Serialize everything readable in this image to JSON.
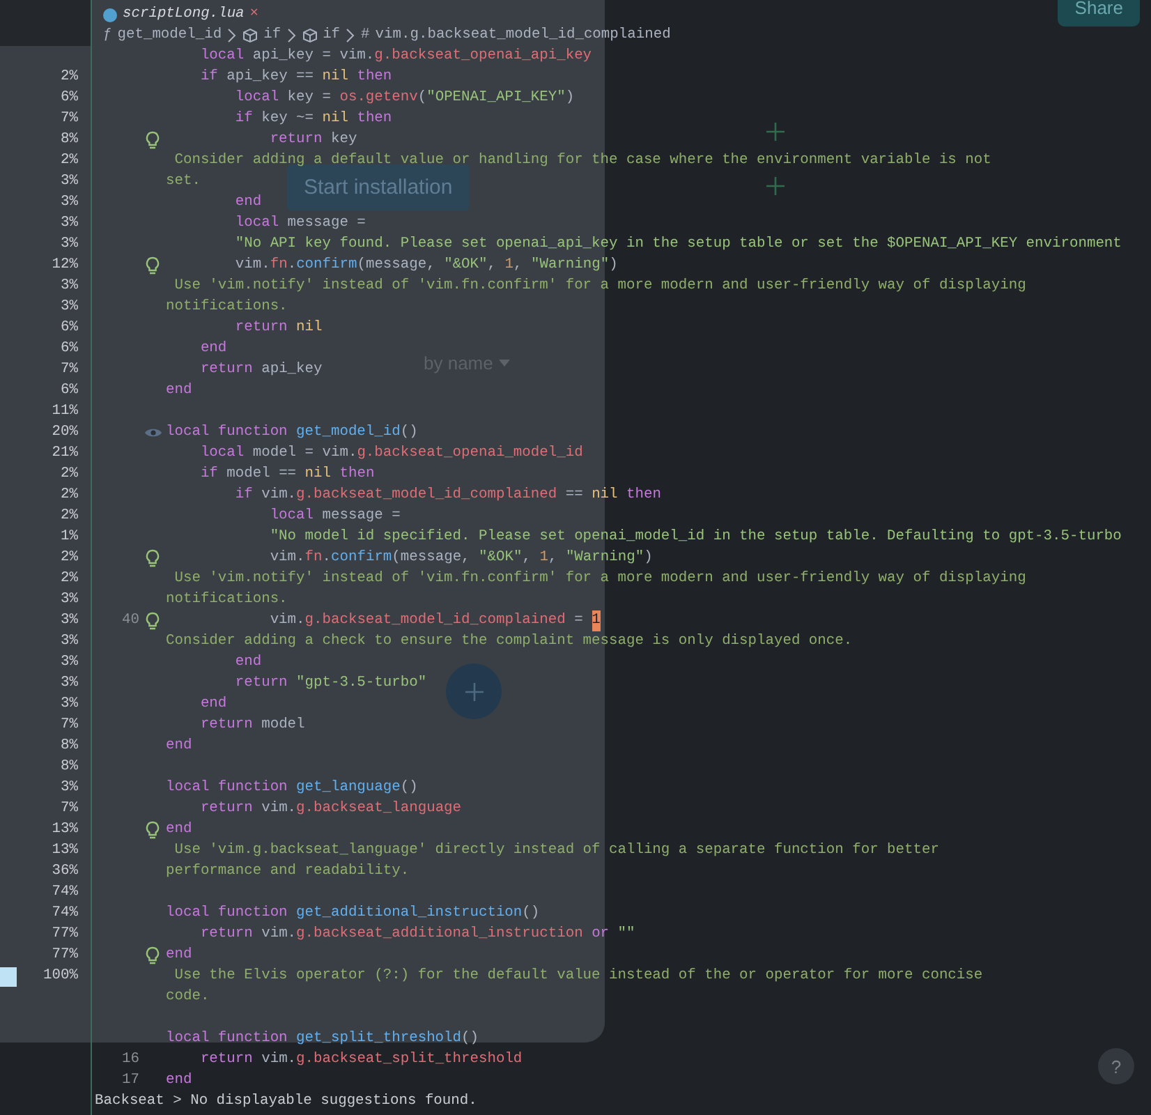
{
  "background_app": {
    "share_button": "Share",
    "install_button": "Start installation",
    "sort": "by name",
    "help_button": "?",
    "percentages": [
      {
        "value": "2%",
        "selected": false
      },
      {
        "value": "6%",
        "selected": false
      },
      {
        "value": "7%",
        "selected": false
      },
      {
        "value": "8%",
        "selected": false
      },
      {
        "value": "2%",
        "selected": false
      },
      {
        "value": "3%",
        "selected": false
      },
      {
        "value": "3%",
        "selected": false
      },
      {
        "value": "3%",
        "selected": false
      },
      {
        "value": "3%",
        "selected": false
      },
      {
        "value": "12%",
        "selected": false
      },
      {
        "value": "3%",
        "selected": false
      },
      {
        "value": "3%",
        "selected": false
      },
      {
        "value": "6%",
        "selected": false
      },
      {
        "value": "6%",
        "selected": false
      },
      {
        "value": "7%",
        "selected": false
      },
      {
        "value": "6%",
        "selected": false
      },
      {
        "value": "11%",
        "selected": false
      },
      {
        "value": "20%",
        "selected": false
      },
      {
        "value": "21%",
        "selected": false
      },
      {
        "value": "2%",
        "selected": false
      },
      {
        "value": "2%",
        "selected": false
      },
      {
        "value": "2%",
        "selected": false
      },
      {
        "value": "1%",
        "selected": false
      },
      {
        "value": "2%",
        "selected": false
      },
      {
        "value": "2%",
        "selected": false
      },
      {
        "value": "3%",
        "selected": false
      },
      {
        "value": "3%",
        "selected": false
      },
      {
        "value": "3%",
        "selected": false
      },
      {
        "value": "3%",
        "selected": false
      },
      {
        "value": "3%",
        "selected": false
      },
      {
        "value": "3%",
        "selected": false
      },
      {
        "value": "7%",
        "selected": false
      },
      {
        "value": "8%",
        "selected": false
      },
      {
        "value": "8%",
        "selected": false
      },
      {
        "value": "3%",
        "selected": false
      },
      {
        "value": "7%",
        "selected": false
      },
      {
        "value": "13%",
        "selected": false
      },
      {
        "value": "13%",
        "selected": false
      },
      {
        "value": "36%",
        "selected": false
      },
      {
        "value": "74%",
        "selected": false
      },
      {
        "value": "74%",
        "selected": false
      },
      {
        "value": "77%",
        "selected": false
      },
      {
        "value": "77%",
        "selected": false
      },
      {
        "value": "100%",
        "selected": true
      }
    ]
  },
  "tab": {
    "filename": "scriptLong.lua",
    "close": "×"
  },
  "breadcrumb": [
    {
      "kind": "function",
      "symbol": "ƒ",
      "text": "get_model_id"
    },
    {
      "kind": "block",
      "text": "if"
    },
    {
      "kind": "block",
      "text": "if"
    },
    {
      "kind": "variable",
      "symbol": "#",
      "text": "vim.g.backseat_model_id_complained"
    }
  ],
  "lines": [
    {
      "kind": "code",
      "tokens": [
        {
          "kind": "keyword",
          "text": "    local"
        },
        {
          "kind": "plain",
          "text": " api_key = vim."
        },
        {
          "kind": "property",
          "text": "g.backseat_openai_api_key"
        }
      ]
    },
    {
      "kind": "code",
      "tokens": [
        {
          "kind": "keyword",
          "text": "    if"
        },
        {
          "kind": "plain",
          "text": " api_key == "
        },
        {
          "kind": "constant",
          "text": "nil"
        },
        {
          "kind": "keyword",
          "text": " then"
        }
      ]
    },
    {
      "kind": "code",
      "tokens": [
        {
          "kind": "keyword",
          "text": "        local"
        },
        {
          "kind": "plain",
          "text": " key = "
        },
        {
          "kind": "property",
          "text": "os.getenv"
        },
        {
          "kind": "plain",
          "text": "("
        },
        {
          "kind": "string",
          "text": "\"OPENAI_API_KEY\""
        },
        {
          "kind": "plain",
          "text": ")"
        }
      ]
    },
    {
      "kind": "code",
      "tokens": [
        {
          "kind": "keyword",
          "text": "        if"
        },
        {
          "kind": "plain",
          "text": " key ~= "
        },
        {
          "kind": "constant",
          "text": "nil"
        },
        {
          "kind": "keyword",
          "text": " then"
        }
      ]
    },
    {
      "kind": "code",
      "marker": {
        "kind": "bulb"
      },
      "tokens": [
        {
          "kind": "keyword",
          "text": "            return"
        },
        {
          "kind": "plain",
          "text": " key"
        }
      ]
    },
    {
      "kind": "hint",
      "text": " Consider adding a default value or handling for the case where the environment variable is not"
    },
    {
      "kind": "hint",
      "text": "set."
    },
    {
      "kind": "code",
      "tokens": [
        {
          "kind": "keyword",
          "text": "        end"
        }
      ]
    },
    {
      "kind": "code",
      "tokens": [
        {
          "kind": "keyword",
          "text": "        local"
        },
        {
          "kind": "plain",
          "text": " message ="
        }
      ]
    },
    {
      "kind": "code",
      "tokens": [
        {
          "kind": "string",
          "text": "        \"No API key found. Please set openai_api_key in the setup table or set the $OPENAI_API_KEY environment"
        }
      ]
    },
    {
      "kind": "code",
      "marker": {
        "kind": "bulb"
      },
      "tokens": [
        {
          "kind": "plain",
          "text": "        vim."
        },
        {
          "kind": "property",
          "text": "fn"
        },
        {
          "kind": "plain",
          "text": "."
        },
        {
          "kind": "function",
          "text": "confirm"
        },
        {
          "kind": "plain",
          "text": "(message, "
        },
        {
          "kind": "string",
          "text": "\"&OK\""
        },
        {
          "kind": "plain",
          "text": ", "
        },
        {
          "kind": "number",
          "text": "1"
        },
        {
          "kind": "plain",
          "text": ", "
        },
        {
          "kind": "string",
          "text": "\"Warning\""
        },
        {
          "kind": "plain",
          "text": ")"
        }
      ]
    },
    {
      "kind": "hint",
      "text": " Use 'vim.notify' instead of 'vim.fn.confirm' for a more modern and user-friendly way of displaying"
    },
    {
      "kind": "hint",
      "text": "notifications."
    },
    {
      "kind": "code",
      "tokens": [
        {
          "kind": "keyword",
          "text": "        return"
        },
        {
          "kind": "constant",
          "text": " nil"
        }
      ]
    },
    {
      "kind": "code",
      "tokens": [
        {
          "kind": "keyword",
          "text": "    end"
        }
      ]
    },
    {
      "kind": "code",
      "tokens": [
        {
          "kind": "keyword",
          "text": "    return"
        },
        {
          "kind": "plain",
          "text": " api_key"
        }
      ]
    },
    {
      "kind": "code",
      "tokens": [
        {
          "kind": "keyword",
          "text": "end"
        }
      ]
    },
    {
      "kind": "blank"
    },
    {
      "kind": "code",
      "marker": {
        "kind": "eye"
      },
      "tokens": [
        {
          "kind": "keyword",
          "text": "local function"
        },
        {
          "kind": "function",
          "text": " get_model_id"
        },
        {
          "kind": "plain",
          "text": "()"
        }
      ]
    },
    {
      "kind": "code",
      "tokens": [
        {
          "kind": "keyword",
          "text": "    local"
        },
        {
          "kind": "plain",
          "text": " model = vim."
        },
        {
          "kind": "property",
          "text": "g.backseat_openai_model_id"
        }
      ]
    },
    {
      "kind": "code",
      "tokens": [
        {
          "kind": "keyword",
          "text": "    if"
        },
        {
          "kind": "plain",
          "text": " model == "
        },
        {
          "kind": "constant",
          "text": "nil"
        },
        {
          "kind": "keyword",
          "text": " then"
        }
      ]
    },
    {
      "kind": "code",
      "tokens": [
        {
          "kind": "keyword",
          "text": "        if"
        },
        {
          "kind": "plain",
          "text": " vim."
        },
        {
          "kind": "property",
          "text": "g.backseat_model_id_complained"
        },
        {
          "kind": "plain",
          "text": " == "
        },
        {
          "kind": "constant",
          "text": "nil"
        },
        {
          "kind": "keyword",
          "text": " then"
        }
      ]
    },
    {
      "kind": "code",
      "tokens": [
        {
          "kind": "keyword",
          "text": "            local"
        },
        {
          "kind": "plain",
          "text": " message ="
        }
      ]
    },
    {
      "kind": "code",
      "tokens": [
        {
          "kind": "string",
          "text": "            \"No model id specified. Please set openai_model_id in the setup table. Defaulting to gpt-3.5-turbo"
        }
      ]
    },
    {
      "kind": "code",
      "marker": {
        "kind": "bulb"
      },
      "tokens": [
        {
          "kind": "plain",
          "text": "            vim."
        },
        {
          "kind": "property",
          "text": "fn"
        },
        {
          "kind": "plain",
          "text": "."
        },
        {
          "kind": "function",
          "text": "confirm"
        },
        {
          "kind": "plain",
          "text": "(message, "
        },
        {
          "kind": "string",
          "text": "\"&OK\""
        },
        {
          "kind": "plain",
          "text": ", "
        },
        {
          "kind": "number",
          "text": "1"
        },
        {
          "kind": "plain",
          "text": ", "
        },
        {
          "kind": "string",
          "text": "\"Warning\""
        },
        {
          "kind": "plain",
          "text": ")"
        }
      ]
    },
    {
      "kind": "hint",
      "text": " Use 'vim.notify' instead of 'vim.fn.confirm' for a more modern and user-friendly way of displaying"
    },
    {
      "kind": "hint",
      "text": "notifications."
    },
    {
      "kind": "code",
      "marker": {
        "kind": "bulb"
      },
      "number": "40",
      "tokens": [
        {
          "kind": "plain",
          "text": "            vim."
        },
        {
          "kind": "property",
          "text": "g.backseat_model_id_complained"
        },
        {
          "kind": "plain",
          "text": " = "
        },
        {
          "kind": "cursor",
          "text": "1"
        }
      ]
    },
    {
      "kind": "hint",
      "text": "Consider adding a check to ensure the complaint message is only displayed once."
    },
    {
      "kind": "code",
      "tokens": [
        {
          "kind": "keyword",
          "text": "        end"
        }
      ]
    },
    {
      "kind": "code",
      "tokens": [
        {
          "kind": "keyword",
          "text": "        return"
        },
        {
          "kind": "string",
          "text": " \"gpt-3.5-turbo\""
        }
      ]
    },
    {
      "kind": "code",
      "tokens": [
        {
          "kind": "keyword",
          "text": "    end"
        }
      ]
    },
    {
      "kind": "code",
      "tokens": [
        {
          "kind": "keyword",
          "text": "    return"
        },
        {
          "kind": "plain",
          "text": " model"
        }
      ]
    },
    {
      "kind": "code",
      "tokens": [
        {
          "kind": "keyword",
          "text": "end"
        }
      ]
    },
    {
      "kind": "blank"
    },
    {
      "kind": "code",
      "tokens": [
        {
          "kind": "keyword",
          "text": "local function"
        },
        {
          "kind": "function",
          "text": " get_language"
        },
        {
          "kind": "plain",
          "text": "()"
        }
      ]
    },
    {
      "kind": "code",
      "tokens": [
        {
          "kind": "keyword",
          "text": "    return"
        },
        {
          "kind": "plain",
          "text": " vim."
        },
        {
          "kind": "property",
          "text": "g.backseat_language"
        }
      ]
    },
    {
      "kind": "code",
      "marker": {
        "kind": "bulb"
      },
      "tokens": [
        {
          "kind": "keyword",
          "text": "end"
        }
      ]
    },
    {
      "kind": "hint",
      "text": " Use 'vim.g.backseat_language' directly instead of calling a separate function for better"
    },
    {
      "kind": "hint",
      "text": "performance and readability."
    },
    {
      "kind": "blank"
    },
    {
      "kind": "code",
      "tokens": [
        {
          "kind": "keyword",
          "text": "local function"
        },
        {
          "kind": "function",
          "text": " get_additional_instruction"
        },
        {
          "kind": "plain",
          "text": "()"
        }
      ]
    },
    {
      "kind": "code",
      "tokens": [
        {
          "kind": "keyword",
          "text": "    return"
        },
        {
          "kind": "plain",
          "text": " vim."
        },
        {
          "kind": "property",
          "text": "g.backseat_additional_instruction"
        },
        {
          "kind": "keyword",
          "text": " or"
        },
        {
          "kind": "string",
          "text": " \"\""
        }
      ]
    },
    {
      "kind": "code",
      "marker": {
        "kind": "bulb"
      },
      "tokens": [
        {
          "kind": "keyword",
          "text": "end"
        }
      ]
    },
    {
      "kind": "hint",
      "text": " Use the Elvis operator (?:) for the default value instead of the or operator for more concise"
    },
    {
      "kind": "hint",
      "text": "code."
    },
    {
      "kind": "blank"
    },
    {
      "kind": "code",
      "tokens": [
        {
          "kind": "keyword",
          "text": "local function"
        },
        {
          "kind": "function",
          "text": " get_split_threshold"
        },
        {
          "kind": "plain",
          "text": "()"
        }
      ]
    },
    {
      "kind": "code",
      "number": "16",
      "tokens": [
        {
          "kind": "keyword",
          "text": "    return"
        },
        {
          "kind": "plain",
          "text": " vim."
        },
        {
          "kind": "property",
          "text": "g.backseat_split_threshold"
        }
      ]
    },
    {
      "kind": "code",
      "number": "17",
      "tokens": [
        {
          "kind": "keyword",
          "text": "end"
        }
      ]
    }
  ],
  "status_line": "Backseat > No displayable suggestions found."
}
